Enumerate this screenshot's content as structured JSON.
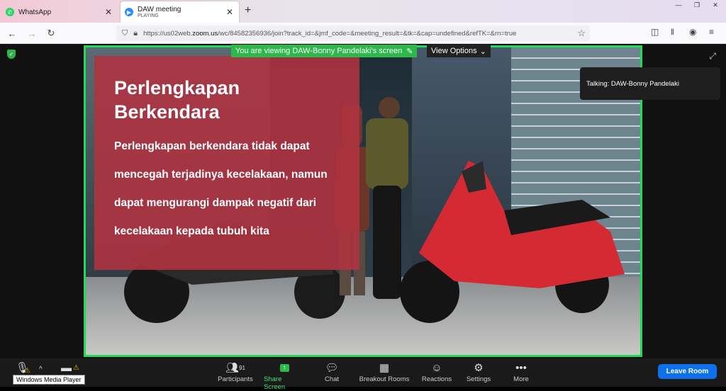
{
  "browser": {
    "tabs": [
      {
        "title": "WhatsApp",
        "icon": "whatsapp-icon"
      },
      {
        "title": "DAW meeting",
        "subtitle": "PLAYING",
        "icon": "zoom-icon"
      }
    ],
    "url_prefix": "https://us02web.",
    "url_domain": "zoom.us",
    "url_rest": "/wc/84582356936/join?track_id=&jmf_code=&meeting_result=&tk=&cap=undefined&refTK=&rn=true"
  },
  "meeting": {
    "banner": "You are viewing DAW-Bonny Pandelaki's screen",
    "view_options": "View Options",
    "talking": "Talking: DAW-Bonny Pandelaki",
    "slide": {
      "title_line1": "Perlengkapan",
      "title_line2": "Berkendara",
      "lines": [
        "Perlengkapan berkendara tidak dapat",
        "mencegah terjadinya kecelakaan, namun",
        "dapat mengurangi dampak negatif dari",
        "kecelakaan kepada tubuh kita"
      ]
    }
  },
  "toolbar": {
    "tooltip": "Windows Media Player",
    "participants_count": "91",
    "participants": "Participants",
    "share": "Share Screen",
    "chat": "Chat",
    "breakout": "Breakout Rooms",
    "reactions": "Reactions",
    "settings": "Settings",
    "more": "More",
    "leave": "Leave Room"
  },
  "colors": {
    "accent_green": "#23d959",
    "leave_blue": "#0e71eb",
    "slide_red": "#b23240"
  }
}
